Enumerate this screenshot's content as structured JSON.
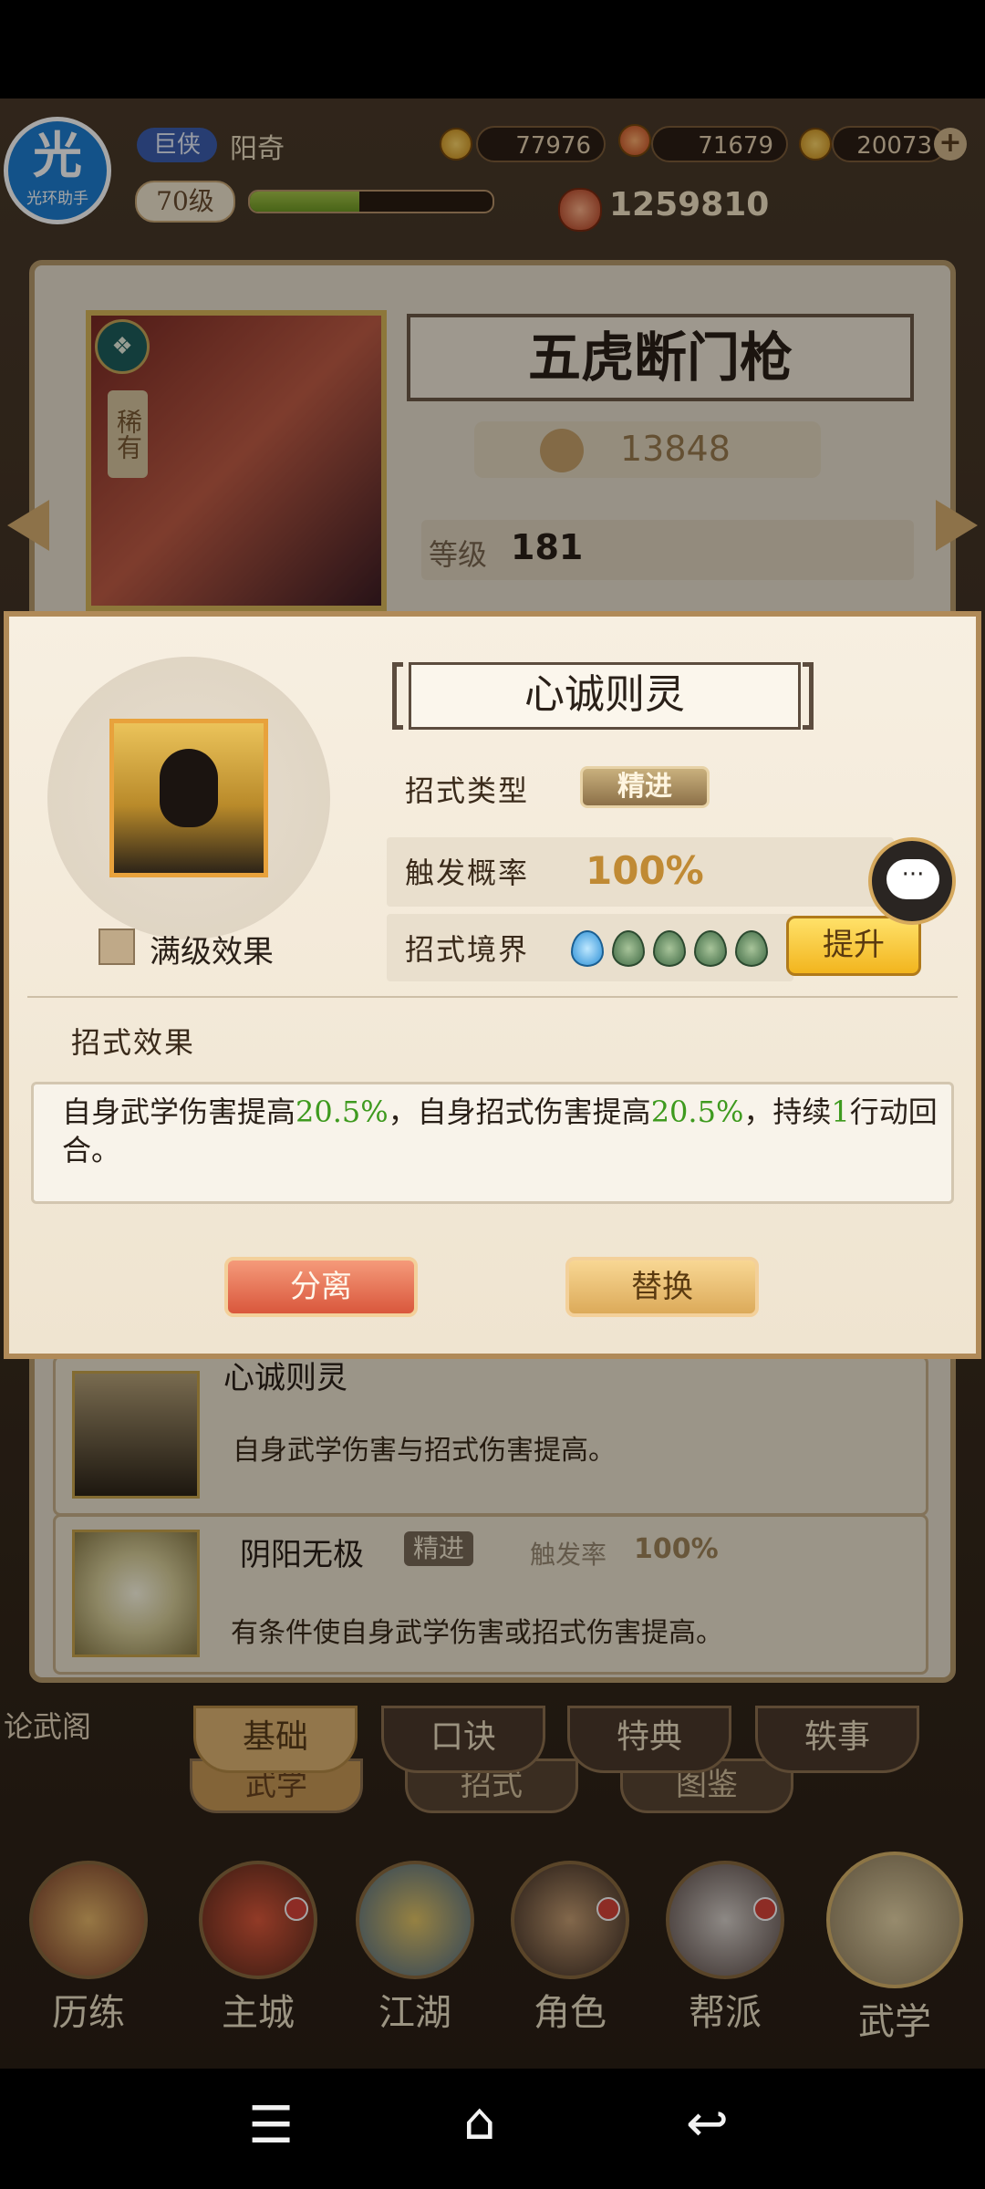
{
  "top_bar": {
    "logo_char": "光",
    "logo_text": "光环助手",
    "rank": "巨侠",
    "player_name": "阳奇",
    "level": "70级",
    "exp_progress": 0.45,
    "coins": "77976",
    "ingots": "71679",
    "gold": "20073",
    "plus": "+",
    "power": "1259810"
  },
  "weapon": {
    "name": "五虎断门枪",
    "rarity": "稀有",
    "score": "13848",
    "level_label": "等级",
    "level": "181"
  },
  "modal": {
    "title": "心诚则灵",
    "max_effect_label": "满级效果",
    "type_label": "招式类型",
    "type_value": "精进",
    "chance_label": "触发概率",
    "chance_value": "100%",
    "realm_label": "招式境界",
    "realm_filled": 1,
    "realm_total": 5,
    "upgrade_label": "提升",
    "chat_glyph": "···",
    "effect_label": "招式效果",
    "effect_segments": [
      {
        "text": "自身武学伤害提高",
        "highlight": false
      },
      {
        "text": "20.5%",
        "highlight": true
      },
      {
        "text": "，自身招式伤害提高",
        "highlight": false
      },
      {
        "text": "20.5%",
        "highlight": true
      },
      {
        "text": "，持续",
        "highlight": false
      },
      {
        "text": "1",
        "highlight": true
      },
      {
        "text": "行动回合。",
        "highlight": false
      }
    ],
    "separate_label": "分离",
    "replace_label": "替换"
  },
  "skill_list": [
    {
      "name": "心诚则灵",
      "tag": "精进",
      "rate_label": "触发率",
      "rate": "100%",
      "desc": "自身武学伤害与招式伤害提高。"
    },
    {
      "name": "阴阳无极",
      "tag": "精进",
      "rate_label": "触发率",
      "rate": "100%",
      "desc": "有条件使自身武学伤害或招式伤害提高。"
    }
  ],
  "side_label": "论武阁",
  "sub_tabs": [
    "基础",
    "口诀",
    "特典",
    "轶事"
  ],
  "sub_tabs_2": [
    "武学",
    "招式",
    "图鉴"
  ],
  "bottom_nav": [
    {
      "label": "历练",
      "dot": false
    },
    {
      "label": "主城",
      "dot": true
    },
    {
      "label": "江湖",
      "dot": false
    },
    {
      "label": "角色",
      "dot": true
    },
    {
      "label": "帮派",
      "dot": true
    },
    {
      "label": "武学",
      "dot": false
    }
  ],
  "system_nav": {
    "menu": "☰",
    "home": "⌂",
    "back": "↩"
  },
  "colors": {
    "highlight_green": "#3e9a1e",
    "modal_border": "#b08a58",
    "upgrade_gold": "#f2b51e"
  }
}
